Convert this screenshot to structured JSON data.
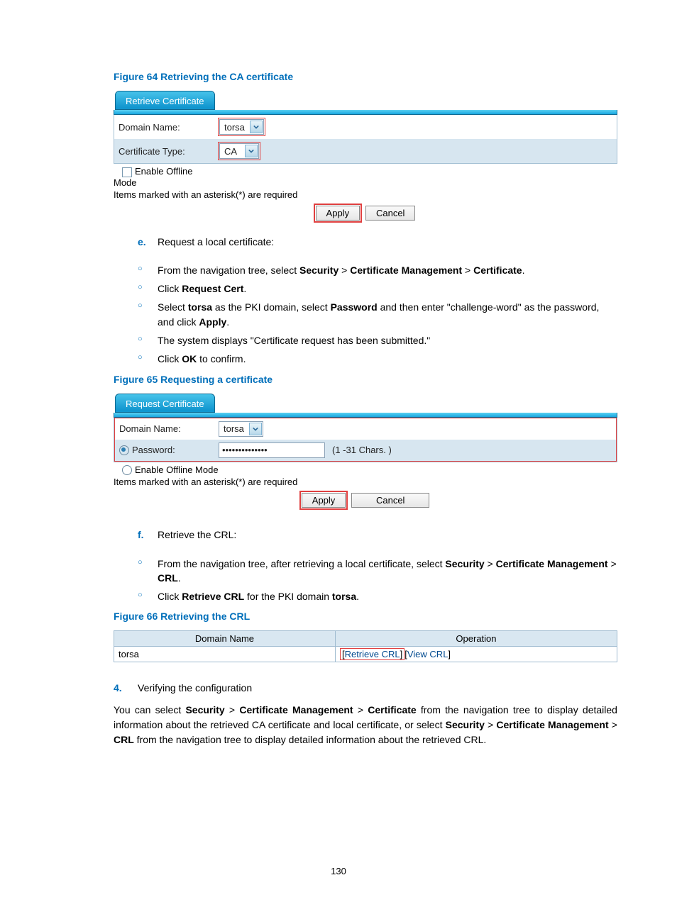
{
  "figures": {
    "f64": {
      "caption": "Figure 64 Retrieving the CA certificate"
    },
    "f65": {
      "caption": "Figure 65 Requesting a certificate"
    },
    "f66": {
      "caption": "Figure 66 Retrieving the CRL"
    }
  },
  "panel64": {
    "tab": "Retrieve Certificate",
    "domain_label": "Domain Name:",
    "domain_value": "torsa",
    "cert_type_label": "Certificate Type:",
    "cert_type_value": "CA",
    "enable_offline": "Enable Offline",
    "mode_label": "Mode",
    "note": "Items marked with an asterisk(*) are required",
    "apply": "Apply",
    "cancel": "Cancel"
  },
  "steps_e": {
    "marker": "e.",
    "title": "Request a local certificate:",
    "s1_a": "From the navigation tree, select ",
    "s1_b": "Security",
    "s1_c": " > ",
    "s1_d": "Certificate Management",
    "s1_e": " > ",
    "s1_f": "Certificate",
    "s1_g": ".",
    "s2_a": "Click ",
    "s2_b": "Request Cert",
    "s2_c": ".",
    "s3_a": "Select ",
    "s3_b": "torsa",
    "s3_c": " as the PKI domain, select ",
    "s3_d": "Password",
    "s3_e": " and then enter \"challenge-word\" as the password, and click ",
    "s3_f": "Apply",
    "s3_g": ".",
    "s4": "The system displays \"Certificate request has been submitted.\"",
    "s5_a": "Click ",
    "s5_b": "OK",
    "s5_c": " to confirm."
  },
  "panel65": {
    "tab": "Request Certificate",
    "domain_label": "Domain Name:",
    "domain_value": "torsa",
    "password_label": "Password:",
    "password_value": "••••••••••••••",
    "password_hint": "(1 -31 Chars. )",
    "enable_offline": "Enable Offline Mode",
    "note": "Items marked with an asterisk(*) are required",
    "apply": "Apply",
    "cancel": "Cancel"
  },
  "steps_f": {
    "marker": "f.",
    "title": "Retrieve the CRL:",
    "s1_a": "From the navigation tree, after retrieving a local certificate, select ",
    "s1_b": "Security",
    "s1_c": " > ",
    "s1_d": "Certificate Management",
    "s1_e": " > ",
    "s1_f": "CRL",
    "s1_g": ".",
    "s2_a": "Click ",
    "s2_b": "Retrieve CRL",
    "s2_c": " for the PKI domain ",
    "s2_d": "torsa",
    "s2_e": "."
  },
  "table66": {
    "h1": "Domain Name",
    "h2": "Operation",
    "row_domain": "torsa",
    "retrieve": "Retrieve CRL",
    "view": "View CRL"
  },
  "step4": {
    "marker": "4.",
    "title": "Verifying the configuration",
    "p_a": "You can select ",
    "p_b": "Security",
    "p_c": " > ",
    "p_d": "Certificate Management",
    "p_e": " > ",
    "p_f": "Certificate",
    "p_g": " from the navigation tree to display detailed information about the retrieved CA certificate and local certificate, or select ",
    "p_h": "Security",
    "p_i": " > ",
    "p_j": "Certificate Management",
    "p_k": " > ",
    "p_l": "CRL",
    "p_m": " from the navigation tree to display detailed information about the retrieved CRL."
  },
  "pagenum": "130"
}
